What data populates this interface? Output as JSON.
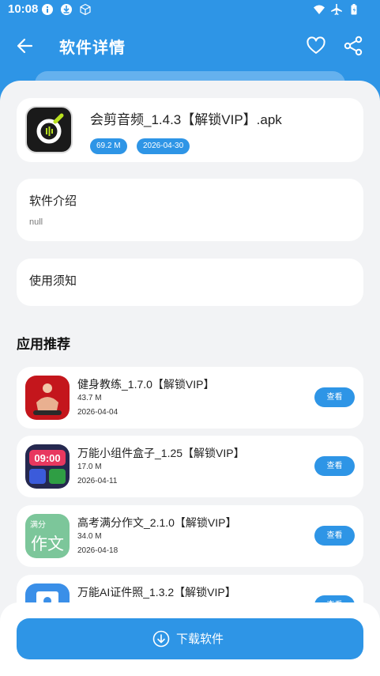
{
  "status_bar": {
    "time": "10:08"
  },
  "header": {
    "title": "软件详情"
  },
  "app": {
    "name": "会剪音频_1.4.3【解锁VIP】.apk",
    "size": "69.2 M",
    "date": "2026-04-30"
  },
  "intro": {
    "heading": "软件介绍",
    "body": "null"
  },
  "notice": {
    "heading": "使用须知"
  },
  "recommend": {
    "title": "应用推荐",
    "view_label": "查看",
    "items": [
      {
        "name": "健身教练_1.7.0【解锁VIP】",
        "size": "43.7 M",
        "date": "2026-04-04",
        "icon": "fitness-icon"
      },
      {
        "name": "万能小组件盒子_1.25【解锁VIP】",
        "size": "17.0 M",
        "date": "2026-04-11",
        "icon": "widget-box-icon"
      },
      {
        "name": "高考满分作文_2.1.0【解锁VIP】",
        "size": "34.0 M",
        "date": "2026-04-18",
        "icon": "essay-icon"
      },
      {
        "name": "万能AI证件照_1.3.2【解锁VIP】",
        "icon": "id-photo-icon"
      }
    ]
  },
  "download": {
    "label": "下载软件"
  },
  "icon_text": {
    "widget_time": "09:00",
    "essay_small": "满分",
    "essay_big": "作文"
  },
  "colors": {
    "primary": "#2E95E6",
    "background": "#F2F3F5"
  }
}
